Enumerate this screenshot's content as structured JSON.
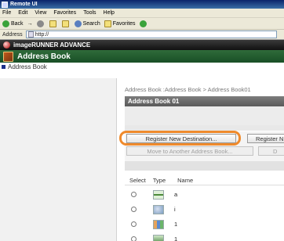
{
  "window": {
    "title": "Remote UI"
  },
  "menu": [
    "File",
    "Edit",
    "View",
    "Favorites",
    "Tools",
    "Help"
  ],
  "toolbar": {
    "back": "Back",
    "forward": "→",
    "search": "Search",
    "favorites": "Favorites"
  },
  "addressbar": {
    "label": "Address",
    "url": "http://"
  },
  "app": {
    "brand": "imageRUNNER ADVANCE",
    "section": "Address Book"
  },
  "leftnav": {
    "item": "Address Book"
  },
  "main": {
    "breadcrumb": "Address Book :Address Book > Address Book01",
    "panel_title": "Address Book 01",
    "buttons": {
      "register_new_destination": "Register New Destination...",
      "register_cut": "Register N",
      "move_to_another": "Move to Another Address Book...",
      "del_cut": "D"
    },
    "table": {
      "headers": {
        "select": "Select",
        "type": "Type",
        "name": "Name"
      },
      "rows": [
        {
          "type": "fax",
          "name": "a"
        },
        {
          "type": "group",
          "name": "i"
        },
        {
          "type": "people",
          "name": "1"
        },
        {
          "type": "person",
          "name": "1"
        }
      ]
    }
  },
  "colors": {
    "highlight": "#ef8a2c",
    "section_green": "#2f6b3a"
  }
}
